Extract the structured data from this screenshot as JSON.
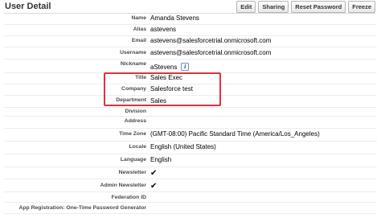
{
  "header": {
    "title": "User Detail",
    "buttons": {
      "edit": "Edit",
      "sharing": "Sharing",
      "reset_password": "Reset Password",
      "freeze": "Freeze"
    }
  },
  "fields": {
    "name": {
      "label": "Name",
      "value": "Amanda Stevens"
    },
    "alias": {
      "label": "Alias",
      "value": "astevens"
    },
    "email": {
      "label": "Email",
      "value": "astevens@salesforcetrial.onmicrosoft.com"
    },
    "username": {
      "label": "Username",
      "value": "astevens@salesforcetrial.onmicrosoft.com"
    },
    "nickname": {
      "label": "Nickname",
      "value": "aStevens",
      "icon": "info-icon"
    },
    "title": {
      "label": "Title",
      "value": "Sales Exec"
    },
    "company": {
      "label": "Company",
      "value": "Salesforce test"
    },
    "department": {
      "label": "Department",
      "value": "Sales"
    },
    "division": {
      "label": "Division",
      "value": ""
    },
    "address": {
      "label": "Address",
      "value": ""
    },
    "time_zone": {
      "label": "Time Zone",
      "value": "(GMT-08:00) Pacific Standard Time (America/Los_Angeles)"
    },
    "locale": {
      "label": "Locale",
      "value": "English (United States)"
    },
    "language": {
      "label": "Language",
      "value": "English"
    },
    "newsletter": {
      "label": "Newsletter",
      "checked": true,
      "icon": "checkmark-icon",
      "glyph": "✔"
    },
    "admin_newsletter": {
      "label": "Admin Newsletter",
      "checked": true,
      "icon": "checkmark-icon",
      "glyph": "✔"
    },
    "federation_id": {
      "label": "Federation ID",
      "value": ""
    },
    "app_registration": {
      "label": "App Registration: One-Time Password Generator",
      "value": ""
    }
  },
  "colors": {
    "highlight_border": "#e3323a"
  }
}
